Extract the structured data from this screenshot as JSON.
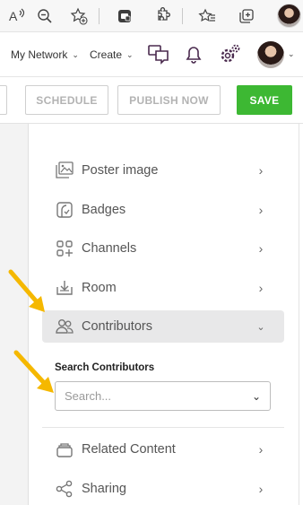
{
  "browser": {
    "icons": [
      "read-aloud-icon",
      "zoom-out-icon",
      "add-favorite-icon",
      "extension-copilot-icon",
      "extensions-icon",
      "favorites-icon",
      "collections-icon",
      "profile-avatar"
    ]
  },
  "header": {
    "menu_network": "My Network",
    "menu_create": "Create",
    "icons": [
      "chat-icon",
      "bell-icon",
      "settings-gear-icon",
      "user-avatar"
    ]
  },
  "actions": {
    "schedule": "SCHEDULE",
    "publish_now": "PUBLISH NOW",
    "save": "SAVE"
  },
  "menu": {
    "items": [
      {
        "label": "Poster image",
        "icon": "image-icon"
      },
      {
        "label": "Badges",
        "icon": "badge-icon"
      },
      {
        "label": "Channels",
        "icon": "channels-grid-icon"
      },
      {
        "label": "Room",
        "icon": "room-download-icon"
      },
      {
        "label": "Contributors",
        "icon": "contributors-icon",
        "expanded": true
      },
      {
        "label": "Related Content",
        "icon": "stack-icon"
      },
      {
        "label": "Sharing",
        "icon": "share-icon"
      }
    ]
  },
  "contributors": {
    "search_label": "Search Contributors",
    "search_placeholder": "Search..."
  },
  "colors": {
    "save_green": "#3db833",
    "active_row": "#e8e8e9",
    "annotation_arrow": "#f5b800"
  }
}
